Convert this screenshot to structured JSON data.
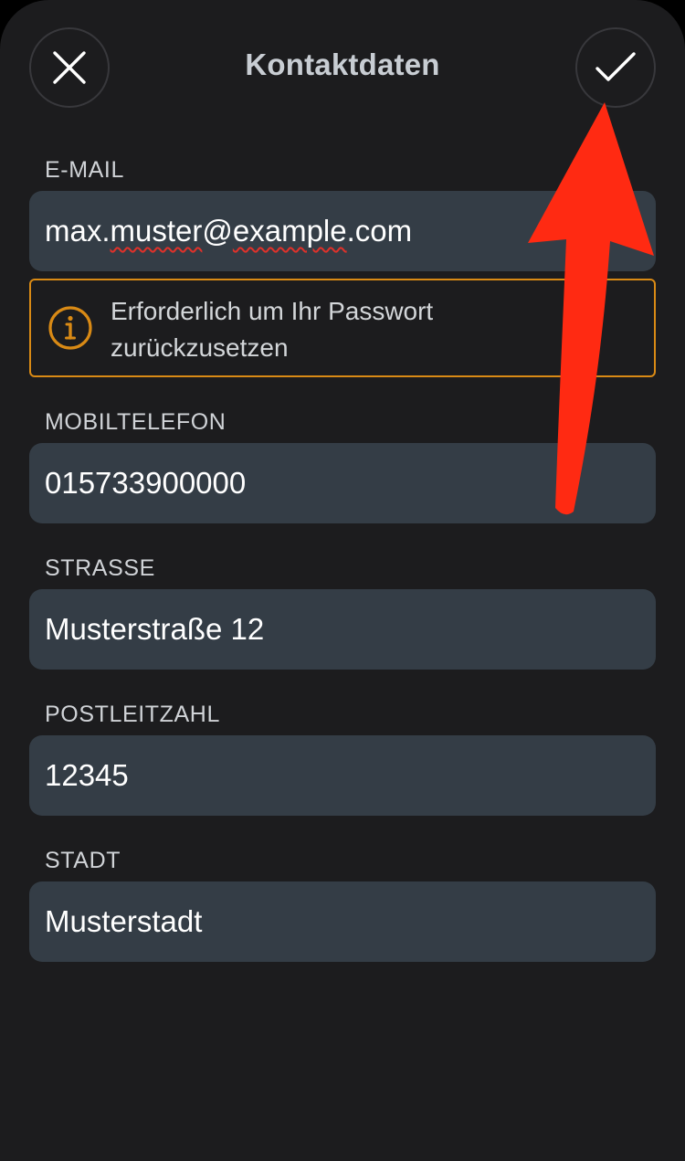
{
  "header": {
    "title": "Kontaktdaten",
    "close_icon": "close-icon",
    "confirm_icon": "checkmark-icon"
  },
  "fields": {
    "email": {
      "label": "E-MAIL",
      "value_part1": "max.",
      "value_part2": "muster",
      "value_part3": "@",
      "value_part4": "example",
      "value_part5": ".com"
    },
    "hint": {
      "icon": "info-icon",
      "line1": "Erforderlich um Ihr Passwort",
      "line2": "zurückzusetzen"
    },
    "mobile": {
      "label": "MOBILTELEFON",
      "value": "015733900000"
    },
    "street": {
      "label": "STRASSE",
      "value": "Musterstraße 12"
    },
    "zip": {
      "label": "POSTLEITZAHL",
      "value": "12345"
    },
    "city": {
      "label": "STADT",
      "value": "Musterstadt"
    }
  },
  "colors": {
    "background": "#1c1c1e",
    "field_background": "#343d46",
    "hint_border": "#d98a15",
    "annotation_arrow": "#ff2a12"
  }
}
